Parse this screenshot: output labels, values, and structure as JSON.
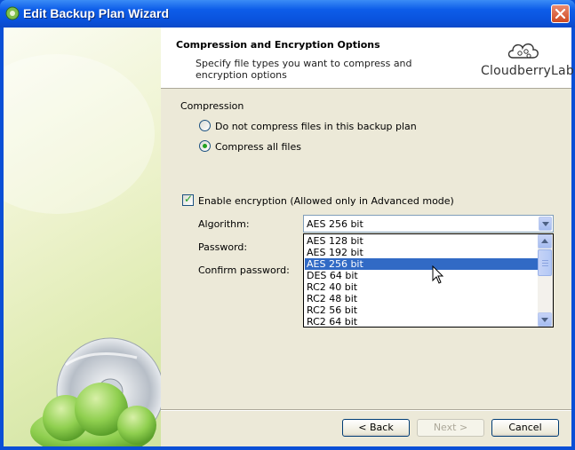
{
  "window": {
    "title": "Edit Backup Plan Wizard"
  },
  "header": {
    "title": "Compression and Encryption Options",
    "description": "Specify file types you want to compress and encryption options",
    "logo_text": "CloudberryLab"
  },
  "compression": {
    "group_label": "Compression",
    "options": [
      {
        "label": "Do not compress files in this backup plan",
        "selected": false
      },
      {
        "label": "Compress all files",
        "selected": true
      }
    ]
  },
  "encryption": {
    "checkbox_label": "Enable encryption (Allowed only in Advanced mode)",
    "enabled": true,
    "algorithm_label": "Algorithm:",
    "password_label": "Password:",
    "confirm_label": "Confirm password:",
    "algorithm_value": "AES 256 bit",
    "algorithm_options": [
      "AES 128 bit",
      "AES 192 bit",
      "AES 256 bit",
      "DES 64 bit",
      "RC2 40 bit",
      "RC2 48 bit",
      "RC2 56 bit",
      "RC2 64 bit"
    ],
    "highlighted_index": 2
  },
  "buttons": {
    "back": "< Back",
    "next": "Next >",
    "cancel": "Cancel"
  },
  "colors": {
    "titlebar": "#0a53de",
    "selection": "#316ac5",
    "radio_dot": "#21a121",
    "dialog_bg": "#ece9d8"
  }
}
